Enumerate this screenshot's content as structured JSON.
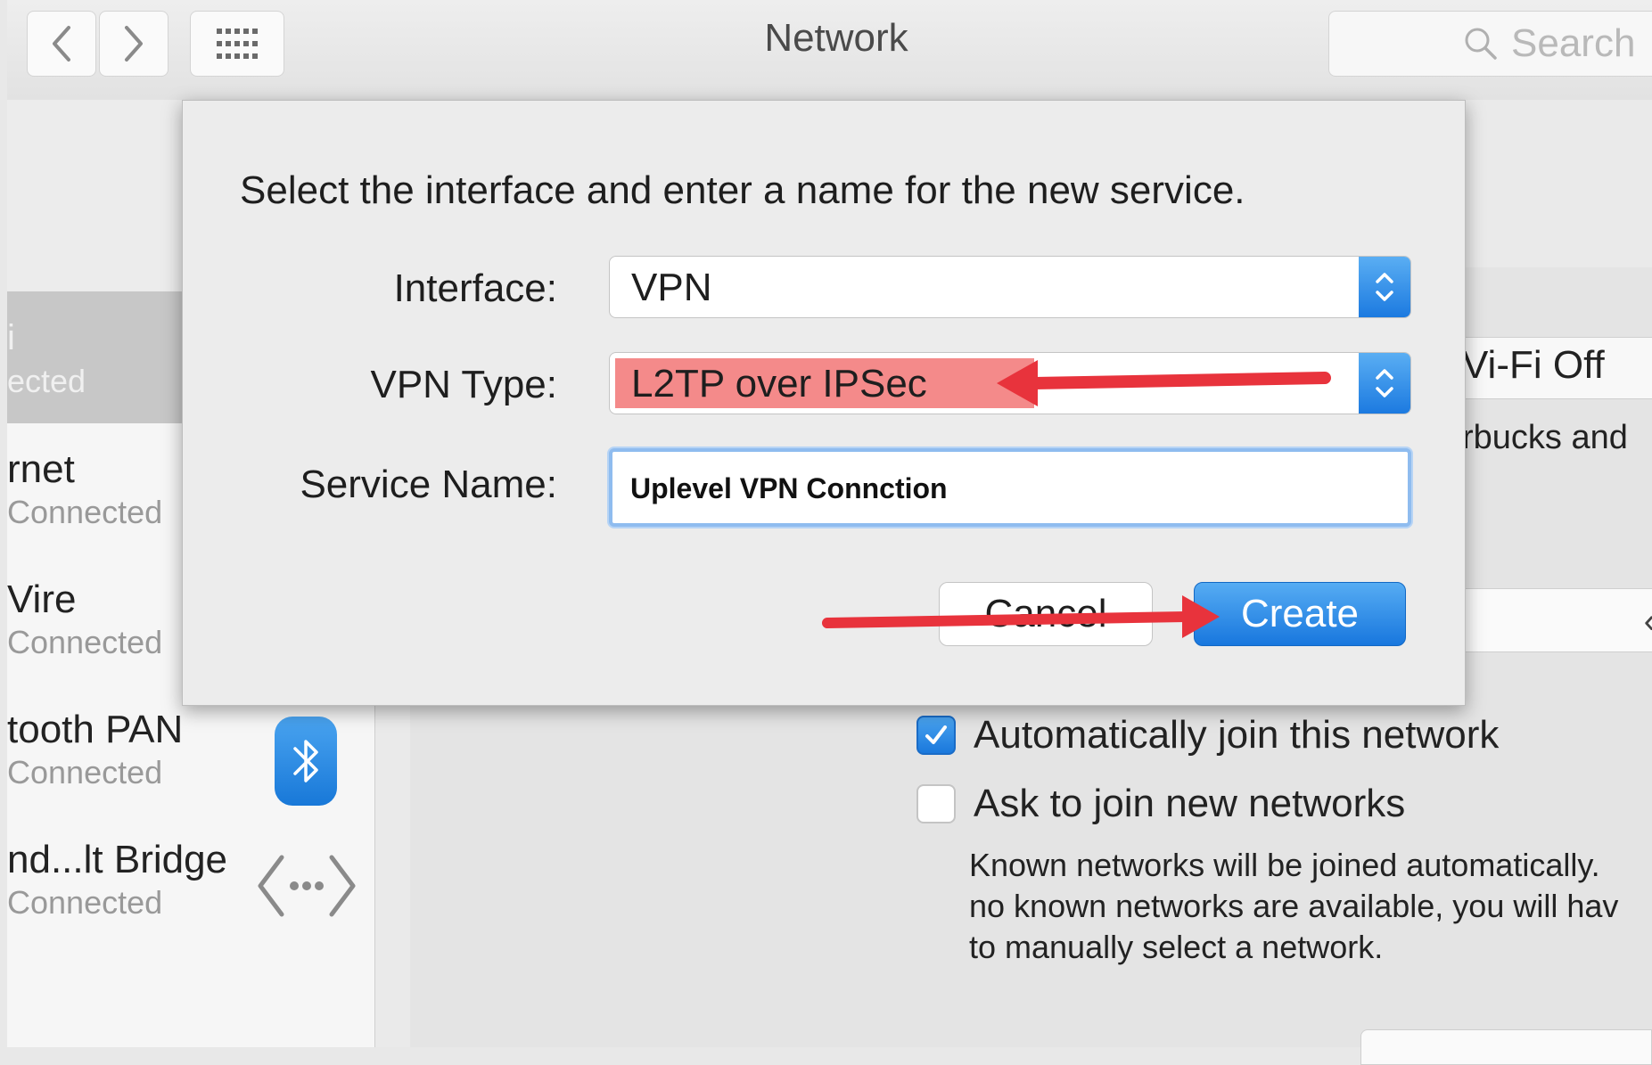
{
  "window": {
    "title": "Network",
    "search_placeholder": "Search"
  },
  "sidebar": {
    "selected": {
      "name": "i",
      "status": "ected"
    },
    "items": [
      {
        "name": "rnet",
        "status": "Connected"
      },
      {
        "name": "Vire",
        "status": "Connected"
      },
      {
        "name": "tooth PAN",
        "status": "Connected"
      },
      {
        "name": "nd...lt Bridge",
        "status": "Connected"
      }
    ]
  },
  "main": {
    "wifi_button_label": "Vi-Fi Off",
    "wifi_desc": "rbucks and",
    "auto_join_label": "Automatically join this network",
    "auto_join_checked": true,
    "ask_join_label": "Ask to join new networks",
    "ask_join_checked": false,
    "hint_lines": [
      "Known networks will be joined automatically.",
      "no known networks are available, you will hav",
      "to manually select a network."
    ]
  },
  "dialog": {
    "message": "Select the interface and enter a name for the new service.",
    "interface_label": "Interface:",
    "interface_value": "VPN",
    "vpn_type_label": "VPN Type:",
    "vpn_type_value": "L2TP over IPSec",
    "service_name_label": "Service Name:",
    "service_name_value": "Uplevel VPN Conncti​on",
    "cancel_label": "Cancel",
    "create_label": "Create"
  },
  "colors": {
    "accent": "#1a78dc",
    "annotation_arrow": "#e8333c",
    "highlight": "#f48a8a"
  }
}
